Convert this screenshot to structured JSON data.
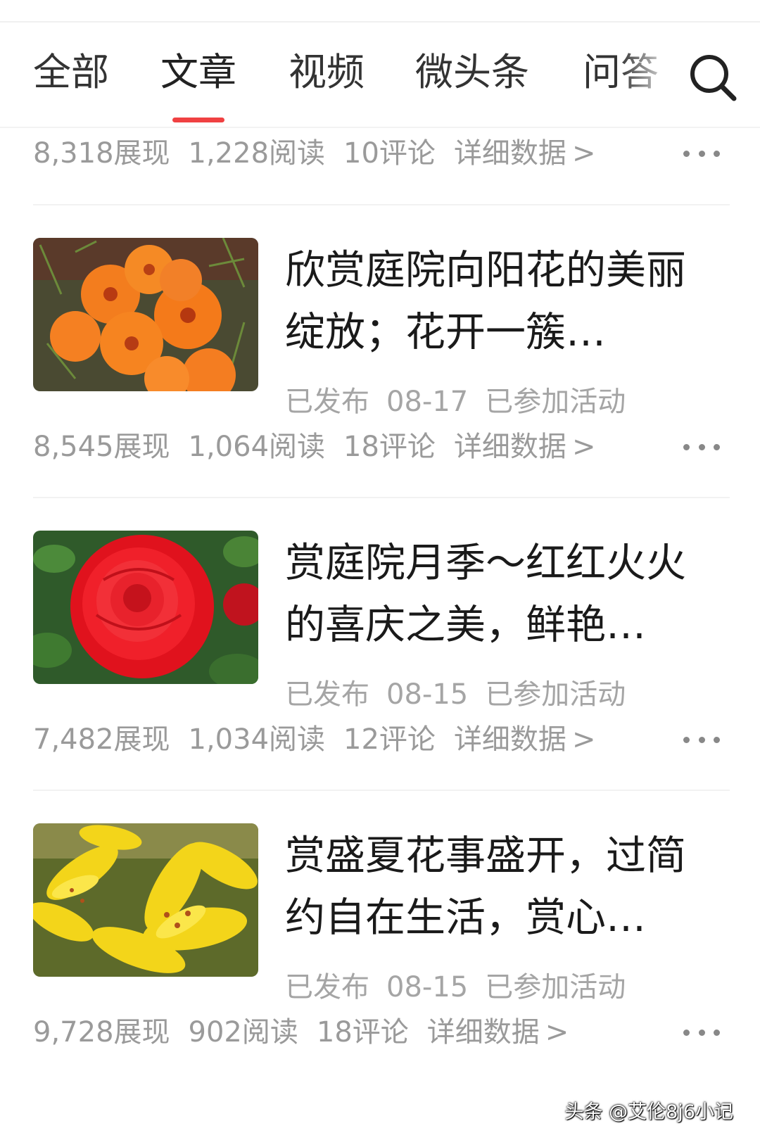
{
  "tabs": [
    {
      "label": "全部",
      "active": false
    },
    {
      "label": "文章",
      "active": true
    },
    {
      "label": "视频",
      "active": false
    },
    {
      "label": "微头条",
      "active": false
    },
    {
      "label": "问答",
      "active": false
    }
  ],
  "search_icon": "search-icon",
  "accent_color": "#f04142",
  "top_stats": {
    "impressions": "8,318展现",
    "reads": "1,228阅读",
    "comments": "10评论",
    "detail": "详细数据"
  },
  "articles": [
    {
      "title": "欣赏庭院向阳花的美丽绽放；花开一簇…",
      "status": "已发布",
      "date": "08-17",
      "activity": "已参加活动",
      "impressions": "8,545展现",
      "reads": "1,064阅读",
      "comments": "18评论",
      "detail": "详细数据"
    },
    {
      "title": "赏庭院月季～红红火火的喜庆之美，鲜艳…",
      "status": "已发布",
      "date": "08-15",
      "activity": "已参加活动",
      "impressions": "7,482展现",
      "reads": "1,034阅读",
      "comments": "12评论",
      "detail": "详细数据"
    },
    {
      "title": "赏盛夏花事盛开，过简约自在生活，赏心…",
      "status": "已发布",
      "date": "08-15",
      "activity": "已参加活动",
      "impressions": "9,728展现",
      "reads": "902阅读",
      "comments": "18评论",
      "detail": "详细数据"
    }
  ],
  "chevron": ">",
  "watermark": "头条 @艾伦8j6小记"
}
